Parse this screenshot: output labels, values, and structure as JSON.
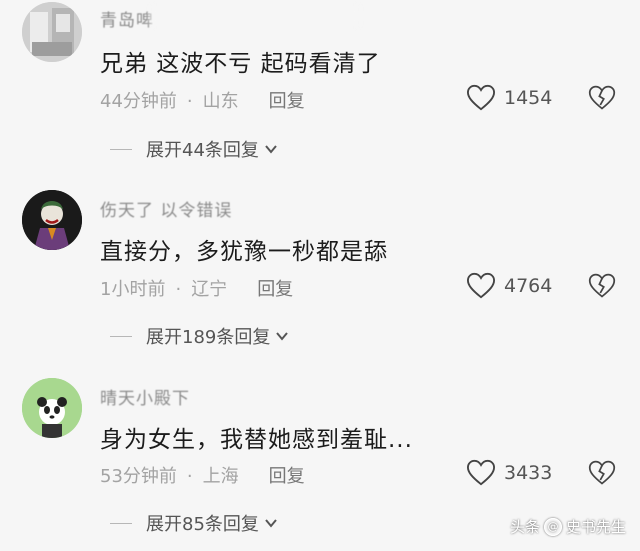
{
  "comments": [
    {
      "username": "青岛啤",
      "content": "兄弟  这波不亏  起码看清了",
      "time": "44分钟前",
      "location": "山东",
      "reply_label": "回复",
      "likes": "1454",
      "expand_label": "展开44条回复"
    },
    {
      "username": "伤天了 以令错误",
      "content": "直接分，多犹豫一秒都是舔",
      "time": "1小时前",
      "location": "辽宁",
      "reply_label": "回复",
      "likes": "4764",
      "expand_label": "展开189条回复"
    },
    {
      "username": "晴天小殿下",
      "content": "身为女生，我替她感到羞耻...",
      "time": "53分钟前",
      "location": "上海",
      "reply_label": "回复",
      "likes": "3433",
      "expand_label": "展开85条回复"
    }
  ],
  "watermark": {
    "source": "头条",
    "author": "史书先生"
  },
  "icons": {
    "like": "heart-outline-icon",
    "dislike": "broken-heart-icon",
    "expand": "chevron-down-icon"
  }
}
